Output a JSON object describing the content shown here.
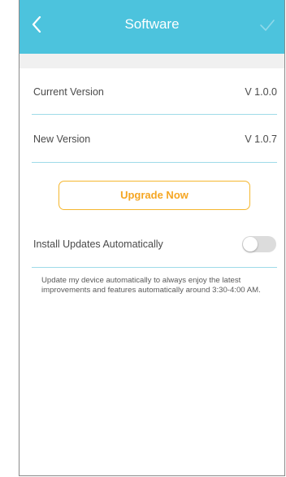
{
  "header": {
    "title": "Software",
    "back_icon": "chevron-left-icon",
    "confirm_icon": "checkmark-icon",
    "background_color": "#4cc3dd"
  },
  "version": {
    "current_label": "Current Version",
    "current_value": "V 1.0.0",
    "new_label": "New Version",
    "new_value": "V 1.0.7"
  },
  "upgrade": {
    "label": "Upgrade Now",
    "accent_color": "#f5a623"
  },
  "auto_update": {
    "label": "Install Updates Automatically",
    "enabled": false,
    "description": "Update my device automatically to always enjoy the latest improvements and features automatically around 3:30-4:00 AM."
  }
}
